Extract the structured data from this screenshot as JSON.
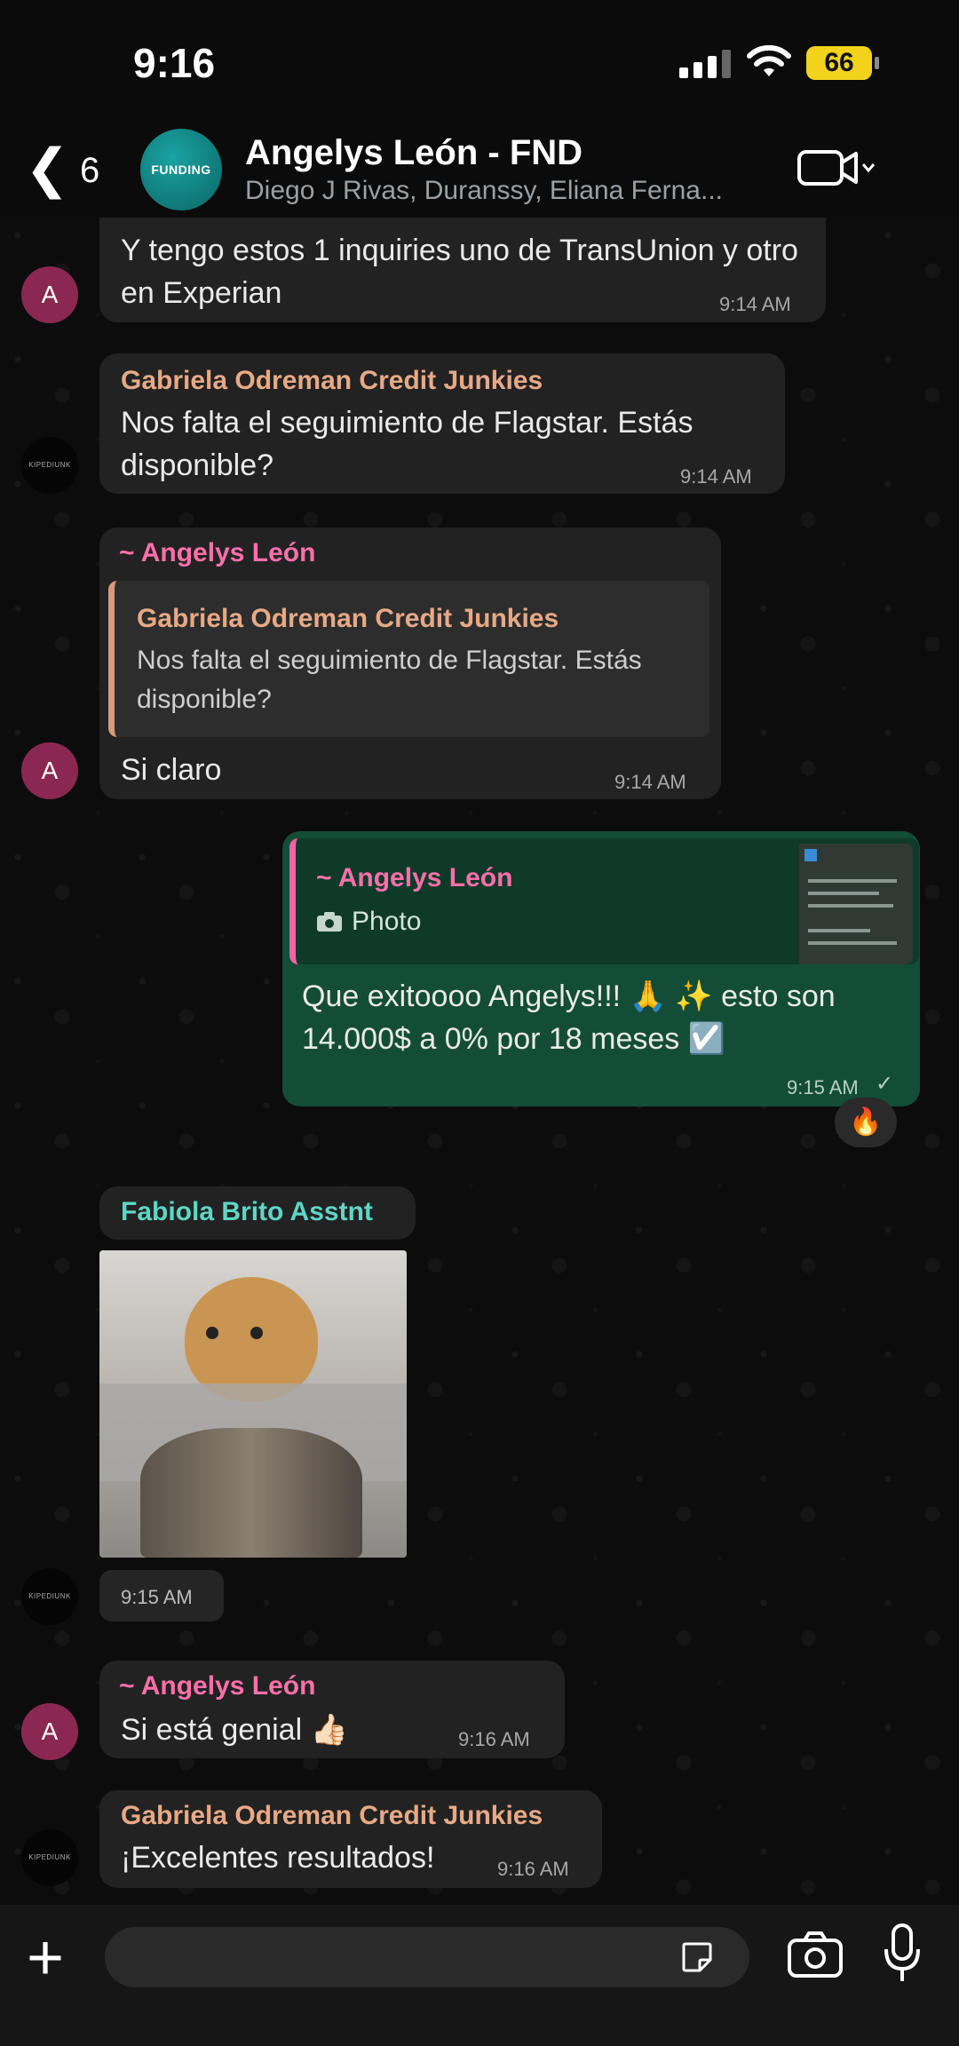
{
  "status_bar": {
    "time": "9:16",
    "battery": "66"
  },
  "header": {
    "back_count": "6",
    "avatar_text": "FUNDING",
    "title": "Angelys León - FND",
    "members": "Diego J Rivas, Duranssy, Eliana Ferna..."
  },
  "messages": [
    {
      "text": "Y tengo estos 1 inquiries uno de TransUnion y otro en Experian",
      "time": "9:14 AM",
      "avatar": "A"
    },
    {
      "sender": "Gabriela Odreman Credit Junkies",
      "text": "Nos falta el seguimiento de Flagstar. Estás disponible?",
      "time": "9:14 AM",
      "avatar": "KIPEDIUNK"
    },
    {
      "sender": "~ Angelys León",
      "quote_sender": "Gabriela Odreman Credit Junkies",
      "quote_text": "Nos falta el seguimiento de Flagstar. Estás disponible?",
      "text": "Si claro",
      "time": "9:14 AM",
      "avatar": "A"
    },
    {
      "quote_sender": "~ Angelys León",
      "quote_text": "Photo",
      "text": "Que exitoooo Angelys!!! 🙏 ✨ esto son 14.000$ a 0% por 18 meses ☑️",
      "time": "9:15 AM",
      "reaction": "🔥"
    },
    {
      "sender": "Fabiola Brito Asstnt",
      "time": "9:15 AM",
      "avatar": "KIPEDIUNK"
    },
    {
      "sender": "~ Angelys León",
      "text": "Si está genial 👍🏻",
      "time": "9:16 AM",
      "avatar": "A"
    },
    {
      "sender": "Gabriela Odreman Credit Junkies",
      "text": "¡Excelentes resultados!",
      "time": "9:16 AM",
      "avatar": "KIPEDIUNK"
    }
  ],
  "colors": {
    "sender_gabriela": "#e7a985",
    "sender_angelys": "#ff6fa8",
    "sender_fabiola": "#5fd6c5",
    "outgoing_bubble": "#144d37",
    "incoming_bubble": "#222222"
  }
}
